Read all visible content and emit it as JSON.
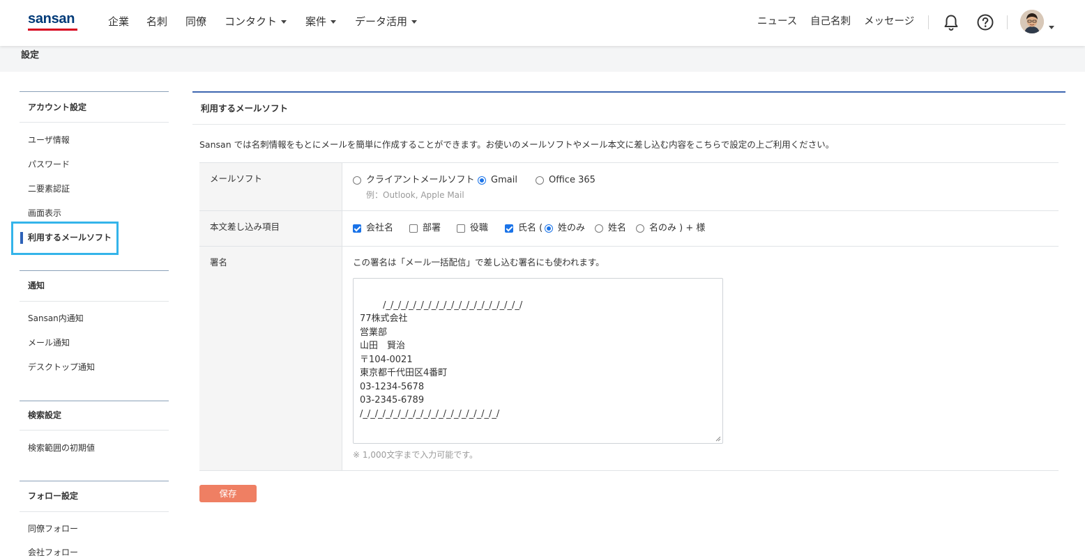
{
  "brand": {
    "logo_text": "sansan"
  },
  "nav": {
    "items": [
      {
        "label": "企業"
      },
      {
        "label": "名刺"
      },
      {
        "label": "同僚"
      },
      {
        "label": "コンタクト"
      },
      {
        "label": "案件"
      },
      {
        "label": "データ活用"
      }
    ],
    "right_links": [
      {
        "label": "ニュース"
      },
      {
        "label": "自己名刺"
      },
      {
        "label": "メッセージ"
      }
    ],
    "icons": [
      "bell-icon",
      "help-icon",
      "avatar",
      "chevron-down-icon"
    ]
  },
  "page": {
    "title": "設定"
  },
  "sidebar": {
    "sections": [
      {
        "heading": "アカウント設定",
        "items": [
          "ユーザ情報",
          "パスワード",
          "二要素認証",
          "画面表示",
          "利用するメールソフト"
        ]
      },
      {
        "heading": "通知",
        "items": [
          "Sansan内通知",
          "メール通知",
          "デスクトップ通知"
        ]
      },
      {
        "heading": "検索設定",
        "items": [
          "検索範囲の初期値"
        ]
      },
      {
        "heading": "フォロー設定",
        "items": [
          "同僚フォロー",
          "会社フォロー"
        ]
      }
    ],
    "active_item": "利用するメールソフト"
  },
  "main": {
    "section_title": "利用するメールソフト",
    "description": "Sansan では名刺情報をもとにメールを簡単に作成することができます。お使いのメールソフトやメール本文に差し込む内容をこちらで設定の上ご利用ください。",
    "rows": {
      "mail_software": {
        "label": "メールソフト",
        "options": [
          {
            "label": "クライアントメールソフト",
            "selected": false
          },
          {
            "label": "Gmail",
            "selected": true
          },
          {
            "label": "Office 365",
            "selected": false
          }
        ],
        "client_hint": "例：Outlook, Apple Mail"
      },
      "insert_fields": {
        "label": "本文差し込み項目",
        "checkboxes": [
          {
            "label": "会社名",
            "checked": true
          },
          {
            "label": "部署",
            "checked": false
          },
          {
            "label": "役職",
            "checked": false
          },
          {
            "label": "氏名 (",
            "checked": true
          }
        ],
        "name_options": [
          {
            "label": "姓のみ",
            "selected": true
          },
          {
            "label": "姓名",
            "selected": false
          },
          {
            "label": "名のみ ) + 様",
            "selected": false
          }
        ]
      },
      "signature": {
        "label": "署名",
        "note": "この署名は「メール一括配信」で差し込む署名にも使われます。",
        "value": "/_/_/_/_/_/_/_/_/_/_/_/_/_/_/_/_/_/_/\n77株式会社\n営業部\n山田　賢治\n〒104-0021\n東京都千代田区4番町\n03-1234-5678\n03-2345-6789\n/_/_/_/_/_/_/_/_/_/_/_/_/_/_/_/_/_/_/",
        "limit_note": "※ 1,000文字まで入力可能です。"
      }
    },
    "save_label": "保存"
  },
  "colors": {
    "brand_blue": "#003a78",
    "brand_red": "#d6001c",
    "accent_blue": "#2e62b8",
    "highlight_cyan": "#34b4ea",
    "save_button": "#ef7f63"
  }
}
